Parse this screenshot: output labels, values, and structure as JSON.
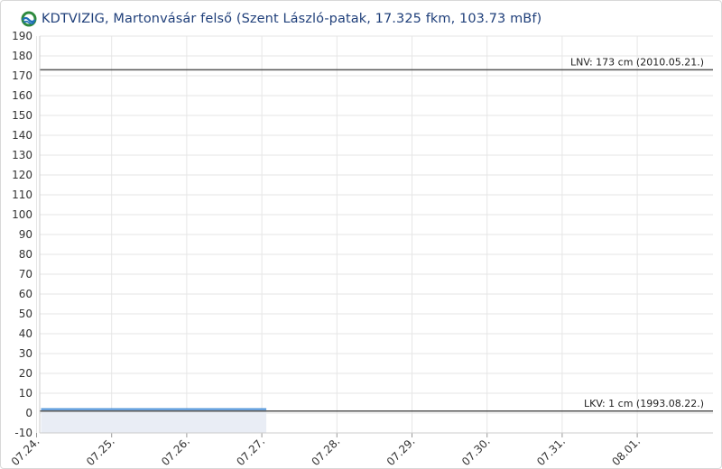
{
  "header": {
    "title": "KDTVIZIG, Martonvásár felső (Szent László-patak, 17.325 fkm, 103.73 mBf)"
  },
  "colors": {
    "title": "#1f3f7a",
    "grid": "#e6e6e6",
    "reference_line": "#555555",
    "series_line": "#4a90d9",
    "observed_band": "#e9edf5"
  },
  "chart_data": {
    "type": "line",
    "title": "KDTVIZIG, Martonvásár felső (Szent László-patak, 17.325 fkm, 103.73 mBf)",
    "xlabel": "",
    "ylabel": "",
    "ylim": [
      -10,
      190
    ],
    "yticks": [
      -10,
      0,
      10,
      20,
      30,
      40,
      50,
      60,
      70,
      80,
      90,
      100,
      110,
      120,
      130,
      140,
      150,
      160,
      170,
      180,
      190
    ],
    "xlim": [
      "07.24.",
      "08.02."
    ],
    "xticks": [
      "07.24.",
      "07.25.",
      "07.26.",
      "07.27.",
      "07.28.",
      "07.29.",
      "07.30.",
      "07.31.",
      "08.01."
    ],
    "grid": true,
    "series": [
      {
        "x": [
          "07.24.",
          "07.25.",
          "07.26.",
          "07.27."
        ],
        "values": [
          2,
          2,
          2,
          2
        ]
      }
    ],
    "observed_range": [
      "07.24.",
      "07.27."
    ],
    "reference_lines": [
      {
        "label": "LNV: 173 cm (2010.05.21.)",
        "value": 173
      },
      {
        "label": "LKV: 1 cm (1993.08.22.)",
        "value": 1
      }
    ]
  }
}
